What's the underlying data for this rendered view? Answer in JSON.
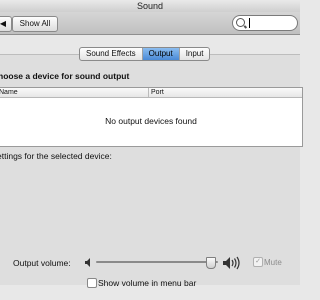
{
  "window": {
    "title": "Sound"
  },
  "toolbar": {
    "back_label": "◀",
    "show_all_label": "Show All"
  },
  "search": {
    "value": ""
  },
  "tabs": [
    {
      "label": "Sound Effects"
    },
    {
      "label": "Output"
    },
    {
      "label": "Input"
    }
  ],
  "selected_tab": "Output",
  "output": {
    "heading": "hoose a device for sound output",
    "columns": {
      "name": "Name",
      "port": "Port"
    },
    "empty_message": "No output devices found",
    "settings_label": "ettings for the selected device:"
  },
  "volume": {
    "label": "Output volume:",
    "level": 0.94,
    "mute_label": "Mute",
    "mute_checked": false,
    "mute_enabled": false,
    "show_in_menubar_label": "Show volume in menu bar",
    "show_in_menubar_checked": false
  },
  "colors": {
    "selected_tab": "#4a8ad6",
    "window_bg": "#dedede"
  }
}
